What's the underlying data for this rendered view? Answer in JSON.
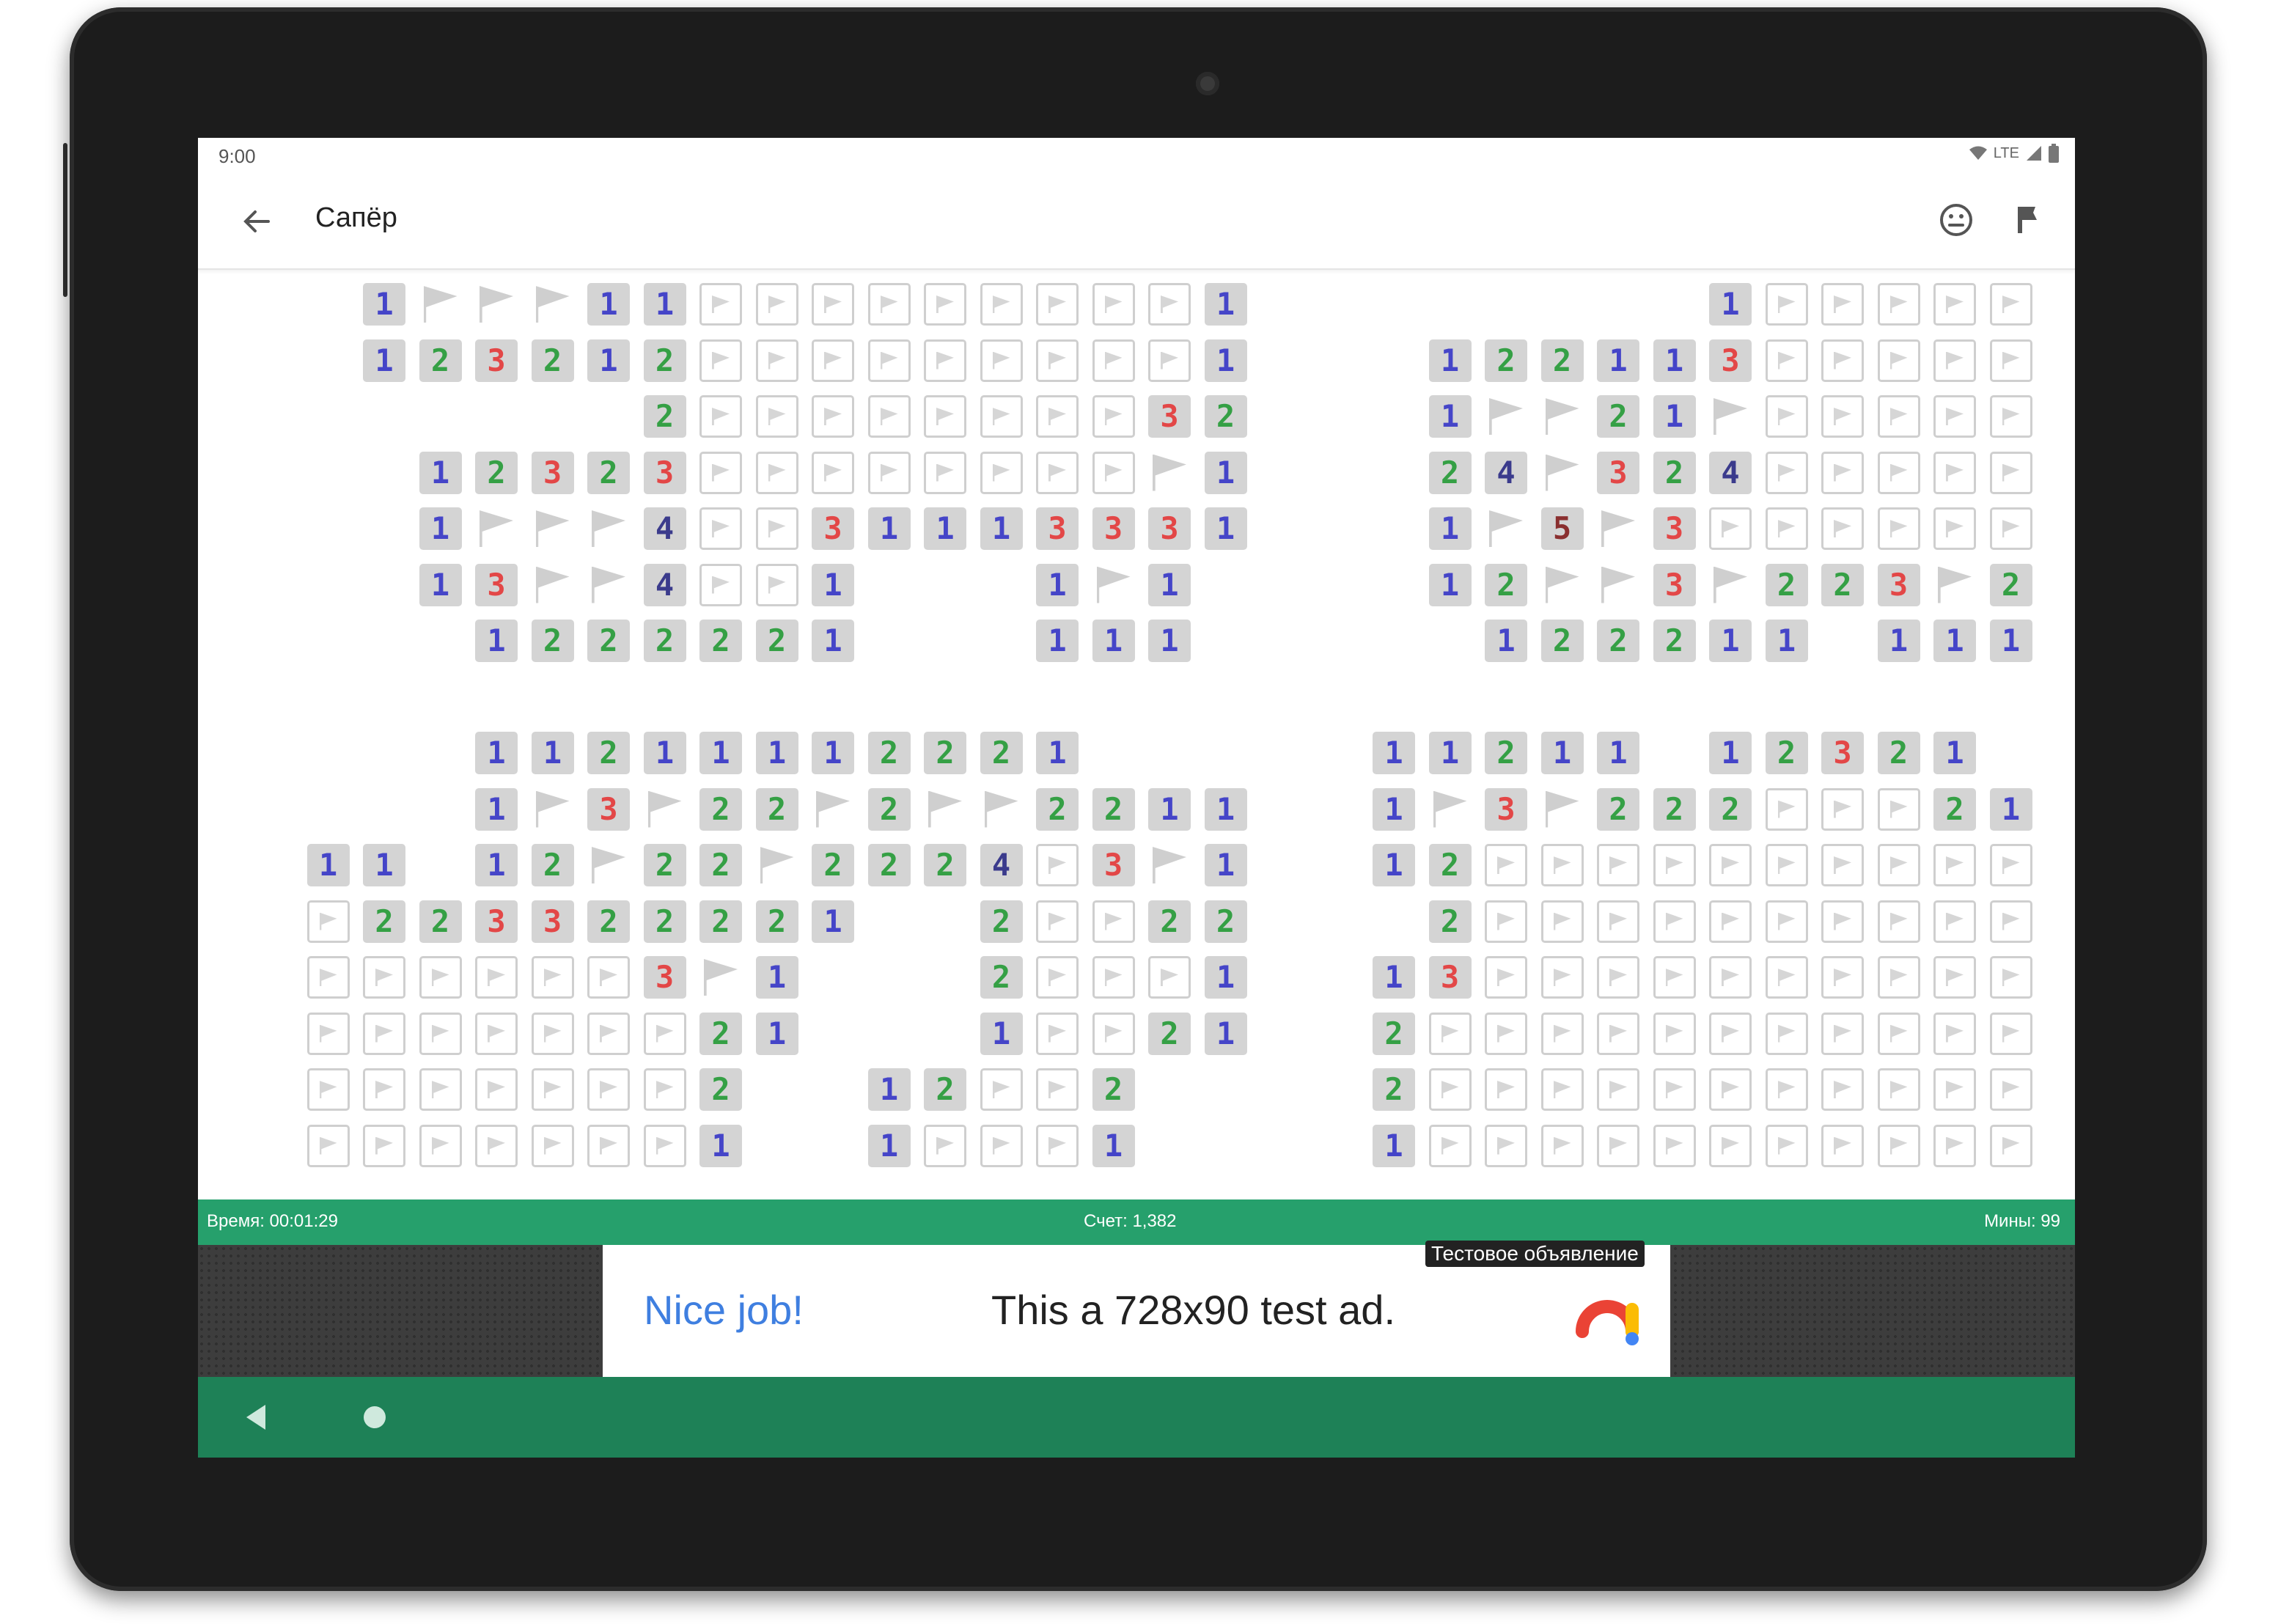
{
  "status_bar": {
    "time": "9:00",
    "network": "LTE"
  },
  "app_bar": {
    "title": "Сапёр"
  },
  "info_bar": {
    "time": "Время: 00:01:29",
    "score": "Счет: 1,382",
    "mines": "Мины: 99"
  },
  "ad": {
    "label": "Тестовое объявление",
    "headline": "Nice job!",
    "body": "This a 728x90 test ad."
  },
  "colors": {
    "info_bar": "#26a06c",
    "nav_bar": "#1e8157",
    "n1": "#4545c8",
    "n2": "#35a045",
    "n3": "#e34747",
    "n4": "#3b3b8c",
    "n5": "#8a2f2f"
  },
  "board": {
    "legend": {
      "H": "hidden-cell",
      "F": "flagged-cell",
      "digit": "revealed-number",
      ".": "revealed-empty"
    },
    "rows": [
      ". . 1 F F F 1 1 H H H H H H H H H 1 . . . . . . . . 1 H H H H H",
      ". . 1 2 3 2 1 2 H H H H H H H H H 1 . . . 1 2 2 1 1 3 H H H H H",
      ". . . . . . . 2 H H H H H H H H 3 2 . . . 1 F F 2 1 F H H H H H",
      ". . . 1 2 3 2 3 H H H H H H H H F 1 . . . 2 4 F 3 2 4 H H H H H",
      ". . . 1 F F F 4 H H 3 1 1 1 3 3 3 1 . . . 1 F 5 F 3 H H H H H H",
      ". . . 1 3 F F 4 H H 1 . . . 1 F 1 . . . . 1 2 F F 3 F 2 2 3 F 2",
      ". . . . 1 2 2 2 2 2 1 . . . 1 1 1 . . . . . 1 2 2 2 1 1 . 1 1 1",
      ". . . . . . . . . . . . . . . . . . . . . . . . . . . . . . . .",
      ". . . . 1 1 2 1 1 1 1 2 2 2 1 . . . . . 1 1 2 1 1 . 1 2 3 2 1 .",
      ". . . . 1 F 3 F 2 2 F 2 F F 2 2 1 1 . . 1 F 3 F 2 2 2 H H H 2 1",
      ". 1 1 . 1 2 F 2 2 F 2 2 2 4 H 3 F 1 . . 1 2 H H H H H H H H H H",
      ". H 2 2 3 3 2 2 2 2 1 . . 2 H H 2 2 . . . 2 H H H H H H H H H H",
      ". H H H H H H 3 F 1 . . . 2 H H H 1 . . 1 3 H H H H H H H H H H",
      ". H H H H H H H 2 1 . . . 1 H H 2 1 . . 2 H H H H H H H H H H H",
      ". H H H H H H H 2 . . 1 2 H H 2 . . . . 2 H H H H H H H H H H H",
      ". H H H H H H H 1 . . 1 H H H 1 . . . . 1 H H H H H H H H H H H"
    ]
  }
}
